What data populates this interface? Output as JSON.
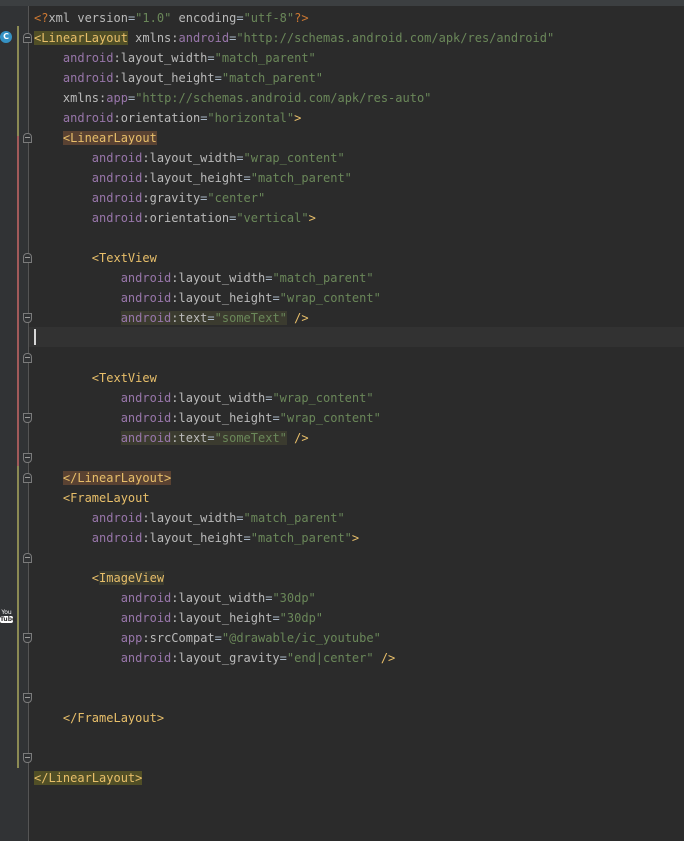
{
  "editor": {
    "icons": {
      "class_badge": "C",
      "youtube_top": "You",
      "youtube_bottom": "Tube"
    },
    "colors": {
      "background": "#2b2b2b",
      "gutter": "#313335",
      "tag": "#e8bf6a",
      "namespace": "#9876aa",
      "attribute": "#bababa",
      "value": "#6a8759",
      "text": "#a9b7c6"
    },
    "lines": [
      [
        {
          "t": "<?",
          "c": "pi"
        },
        {
          "t": "xml version",
          "c": "attr"
        },
        {
          "t": "=",
          "c": "plain"
        },
        {
          "t": "\"1.0\"",
          "c": "val"
        },
        {
          "t": " encoding",
          "c": "attr"
        },
        {
          "t": "=",
          "c": "plain"
        },
        {
          "t": "\"utf-8\"",
          "c": "val"
        },
        {
          "t": "?>",
          "c": "pi"
        }
      ],
      [
        {
          "t": "<LinearLayout",
          "c": "tag",
          "h": "yellow"
        },
        {
          "t": " xmlns:",
          "c": "attr"
        },
        {
          "t": "android",
          "c": "ns"
        },
        {
          "t": "=",
          "c": "plain"
        },
        {
          "t": "\"http://schemas.android.com/apk/res/android\"",
          "c": "val"
        }
      ],
      [
        {
          "t": "    "
        },
        {
          "t": "android",
          "c": "ns"
        },
        {
          "t": ":layout_width",
          "c": "attr"
        },
        {
          "t": "=",
          "c": "plain"
        },
        {
          "t": "\"match_parent\"",
          "c": "val"
        }
      ],
      [
        {
          "t": "    "
        },
        {
          "t": "android",
          "c": "ns"
        },
        {
          "t": ":layout_height",
          "c": "attr"
        },
        {
          "t": "=",
          "c": "plain"
        },
        {
          "t": "\"match_parent\"",
          "c": "val"
        }
      ],
      [
        {
          "t": "    "
        },
        {
          "t": "xmlns:",
          "c": "attr"
        },
        {
          "t": "app",
          "c": "ns"
        },
        {
          "t": "=",
          "c": "plain"
        },
        {
          "t": "\"http://schemas.android.com/apk/res-auto\"",
          "c": "val"
        }
      ],
      [
        {
          "t": "    "
        },
        {
          "t": "android",
          "c": "ns"
        },
        {
          "t": ":orientation",
          "c": "attr"
        },
        {
          "t": "=",
          "c": "plain"
        },
        {
          "t": "\"horizontal\"",
          "c": "val"
        },
        {
          "t": ">",
          "c": "tag"
        }
      ],
      [
        {
          "t": "    "
        },
        {
          "t": "<LinearLayout",
          "c": "tag",
          "h": "brown"
        }
      ],
      [
        {
          "t": "        "
        },
        {
          "t": "android",
          "c": "ns"
        },
        {
          "t": ":layout_width",
          "c": "attr"
        },
        {
          "t": "=",
          "c": "plain"
        },
        {
          "t": "\"wrap_content\"",
          "c": "val"
        }
      ],
      [
        {
          "t": "        "
        },
        {
          "t": "android",
          "c": "ns"
        },
        {
          "t": ":layout_height",
          "c": "attr"
        },
        {
          "t": "=",
          "c": "plain"
        },
        {
          "t": "\"match_parent\"",
          "c": "val"
        }
      ],
      [
        {
          "t": "        "
        },
        {
          "t": "android",
          "c": "ns"
        },
        {
          "t": ":gravity",
          "c": "attr"
        },
        {
          "t": "=",
          "c": "plain"
        },
        {
          "t": "\"center\"",
          "c": "val"
        }
      ],
      [
        {
          "t": "        "
        },
        {
          "t": "android",
          "c": "ns"
        },
        {
          "t": ":orientation",
          "c": "attr"
        },
        {
          "t": "=",
          "c": "plain"
        },
        {
          "t": "\"vertical\"",
          "c": "val"
        },
        {
          "t": ">",
          "c": "tag"
        }
      ],
      [],
      [
        {
          "t": "        "
        },
        {
          "t": "<TextView",
          "c": "tag"
        }
      ],
      [
        {
          "t": "            "
        },
        {
          "t": "android",
          "c": "ns"
        },
        {
          "t": ":layout_width",
          "c": "attr"
        },
        {
          "t": "=",
          "c": "plain"
        },
        {
          "t": "\"match_parent\"",
          "c": "val"
        }
      ],
      [
        {
          "t": "            "
        },
        {
          "t": "android",
          "c": "ns"
        },
        {
          "t": ":layout_height",
          "c": "attr"
        },
        {
          "t": "=",
          "c": "plain"
        },
        {
          "t": "\"wrap_content\"",
          "c": "val"
        }
      ],
      [
        {
          "t": "            "
        },
        {
          "t": "android",
          "c": "ns",
          "h": "olive"
        },
        {
          "t": ":text",
          "c": "attr",
          "h": "olive"
        },
        {
          "t": "=",
          "c": "plain",
          "h": "olive"
        },
        {
          "t": "\"someText\"",
          "c": "val",
          "h": "olive"
        },
        {
          "t": " "
        },
        {
          "t": "/>",
          "c": "tag"
        }
      ],
      [],
      [],
      [
        {
          "t": "        "
        },
        {
          "t": "<TextView",
          "c": "tag"
        }
      ],
      [
        {
          "t": "            "
        },
        {
          "t": "android",
          "c": "ns"
        },
        {
          "t": ":layout_width",
          "c": "attr"
        },
        {
          "t": "=",
          "c": "plain"
        },
        {
          "t": "\"wrap_content\"",
          "c": "val"
        }
      ],
      [
        {
          "t": "            "
        },
        {
          "t": "android",
          "c": "ns"
        },
        {
          "t": ":layout_height",
          "c": "attr"
        },
        {
          "t": "=",
          "c": "plain"
        },
        {
          "t": "\"wrap_content\"",
          "c": "val"
        }
      ],
      [
        {
          "t": "            "
        },
        {
          "t": "android",
          "c": "ns",
          "h": "olive"
        },
        {
          "t": ":text",
          "c": "attr",
          "h": "olive"
        },
        {
          "t": "=",
          "c": "plain",
          "h": "olive"
        },
        {
          "t": "\"someText\"",
          "c": "val",
          "h": "olive"
        },
        {
          "t": " "
        },
        {
          "t": "/>",
          "c": "tag"
        }
      ],
      [],
      [
        {
          "t": "    "
        },
        {
          "t": "</LinearLayout>",
          "c": "tag",
          "h": "brown"
        }
      ],
      [
        {
          "t": "    "
        },
        {
          "t": "<FrameLayout",
          "c": "tag"
        }
      ],
      [
        {
          "t": "        "
        },
        {
          "t": "android",
          "c": "ns"
        },
        {
          "t": ":layout_width",
          "c": "attr"
        },
        {
          "t": "=",
          "c": "plain"
        },
        {
          "t": "\"match_parent\"",
          "c": "val"
        }
      ],
      [
        {
          "t": "        "
        },
        {
          "t": "android",
          "c": "ns"
        },
        {
          "t": ":layout_height",
          "c": "attr"
        },
        {
          "t": "=",
          "c": "plain"
        },
        {
          "t": "\"match_parent\"",
          "c": "val"
        },
        {
          "t": ">",
          "c": "tag"
        }
      ],
      [],
      [
        {
          "t": "        "
        },
        {
          "t": "<",
          "c": "tag"
        },
        {
          "t": "ImageView",
          "c": "tag",
          "h": "olive"
        }
      ],
      [
        {
          "t": "            "
        },
        {
          "t": "android",
          "c": "ns"
        },
        {
          "t": ":layout_width",
          "c": "attr"
        },
        {
          "t": "=",
          "c": "plain"
        },
        {
          "t": "\"30dp\"",
          "c": "val"
        }
      ],
      [
        {
          "t": "            "
        },
        {
          "t": "android",
          "c": "ns"
        },
        {
          "t": ":layout_height",
          "c": "attr"
        },
        {
          "t": "=",
          "c": "plain"
        },
        {
          "t": "\"30dp\"",
          "c": "val"
        }
      ],
      [
        {
          "t": "            "
        },
        {
          "t": "app",
          "c": "ns"
        },
        {
          "t": ":srcCompat",
          "c": "attr"
        },
        {
          "t": "=",
          "c": "plain"
        },
        {
          "t": "\"@drawable/ic_youtube\"",
          "c": "val"
        }
      ],
      [
        {
          "t": "            "
        },
        {
          "t": "android",
          "c": "ns"
        },
        {
          "t": ":layout_gravity",
          "c": "attr"
        },
        {
          "t": "=",
          "c": "plain"
        },
        {
          "t": "\"end|center\"",
          "c": "val"
        },
        {
          "t": " "
        },
        {
          "t": "/>",
          "c": "tag"
        }
      ],
      [],
      [],
      [
        {
          "t": "    "
        },
        {
          "t": "</FrameLayout>",
          "c": "tag"
        }
      ],
      [],
      [],
      [
        {
          "t": "</LinearLayout>",
          "c": "tag",
          "h": "yellow"
        }
      ]
    ]
  }
}
